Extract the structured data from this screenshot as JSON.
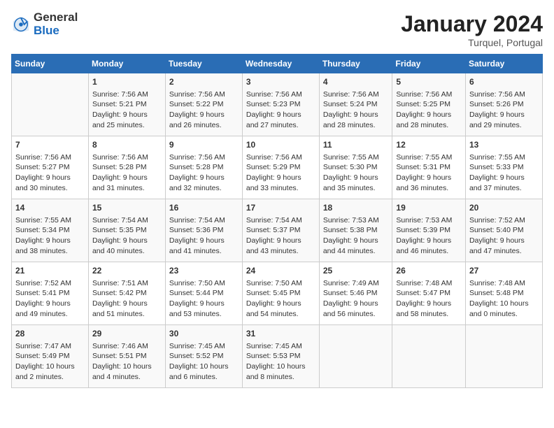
{
  "header": {
    "logo_general": "General",
    "logo_blue": "Blue",
    "title": "January 2024",
    "subtitle": "Turquel, Portugal"
  },
  "days_of_week": [
    "Sunday",
    "Monday",
    "Tuesday",
    "Wednesday",
    "Thursday",
    "Friday",
    "Saturday"
  ],
  "weeks": [
    [
      {
        "day": "",
        "info": ""
      },
      {
        "day": "1",
        "info": "Sunrise: 7:56 AM\nSunset: 5:21 PM\nDaylight: 9 hours\nand 25 minutes."
      },
      {
        "day": "2",
        "info": "Sunrise: 7:56 AM\nSunset: 5:22 PM\nDaylight: 9 hours\nand 26 minutes."
      },
      {
        "day": "3",
        "info": "Sunrise: 7:56 AM\nSunset: 5:23 PM\nDaylight: 9 hours\nand 27 minutes."
      },
      {
        "day": "4",
        "info": "Sunrise: 7:56 AM\nSunset: 5:24 PM\nDaylight: 9 hours\nand 28 minutes."
      },
      {
        "day": "5",
        "info": "Sunrise: 7:56 AM\nSunset: 5:25 PM\nDaylight: 9 hours\nand 28 minutes."
      },
      {
        "day": "6",
        "info": "Sunrise: 7:56 AM\nSunset: 5:26 PM\nDaylight: 9 hours\nand 29 minutes."
      }
    ],
    [
      {
        "day": "7",
        "info": "Sunrise: 7:56 AM\nSunset: 5:27 PM\nDaylight: 9 hours\nand 30 minutes."
      },
      {
        "day": "8",
        "info": "Sunrise: 7:56 AM\nSunset: 5:28 PM\nDaylight: 9 hours\nand 31 minutes."
      },
      {
        "day": "9",
        "info": "Sunrise: 7:56 AM\nSunset: 5:28 PM\nDaylight: 9 hours\nand 32 minutes."
      },
      {
        "day": "10",
        "info": "Sunrise: 7:56 AM\nSunset: 5:29 PM\nDaylight: 9 hours\nand 33 minutes."
      },
      {
        "day": "11",
        "info": "Sunrise: 7:55 AM\nSunset: 5:30 PM\nDaylight: 9 hours\nand 35 minutes."
      },
      {
        "day": "12",
        "info": "Sunrise: 7:55 AM\nSunset: 5:31 PM\nDaylight: 9 hours\nand 36 minutes."
      },
      {
        "day": "13",
        "info": "Sunrise: 7:55 AM\nSunset: 5:33 PM\nDaylight: 9 hours\nand 37 minutes."
      }
    ],
    [
      {
        "day": "14",
        "info": "Sunrise: 7:55 AM\nSunset: 5:34 PM\nDaylight: 9 hours\nand 38 minutes."
      },
      {
        "day": "15",
        "info": "Sunrise: 7:54 AM\nSunset: 5:35 PM\nDaylight: 9 hours\nand 40 minutes."
      },
      {
        "day": "16",
        "info": "Sunrise: 7:54 AM\nSunset: 5:36 PM\nDaylight: 9 hours\nand 41 minutes."
      },
      {
        "day": "17",
        "info": "Sunrise: 7:54 AM\nSunset: 5:37 PM\nDaylight: 9 hours\nand 43 minutes."
      },
      {
        "day": "18",
        "info": "Sunrise: 7:53 AM\nSunset: 5:38 PM\nDaylight: 9 hours\nand 44 minutes."
      },
      {
        "day": "19",
        "info": "Sunrise: 7:53 AM\nSunset: 5:39 PM\nDaylight: 9 hours\nand 46 minutes."
      },
      {
        "day": "20",
        "info": "Sunrise: 7:52 AM\nSunset: 5:40 PM\nDaylight: 9 hours\nand 47 minutes."
      }
    ],
    [
      {
        "day": "21",
        "info": "Sunrise: 7:52 AM\nSunset: 5:41 PM\nDaylight: 9 hours\nand 49 minutes."
      },
      {
        "day": "22",
        "info": "Sunrise: 7:51 AM\nSunset: 5:42 PM\nDaylight: 9 hours\nand 51 minutes."
      },
      {
        "day": "23",
        "info": "Sunrise: 7:50 AM\nSunset: 5:44 PM\nDaylight: 9 hours\nand 53 minutes."
      },
      {
        "day": "24",
        "info": "Sunrise: 7:50 AM\nSunset: 5:45 PM\nDaylight: 9 hours\nand 54 minutes."
      },
      {
        "day": "25",
        "info": "Sunrise: 7:49 AM\nSunset: 5:46 PM\nDaylight: 9 hours\nand 56 minutes."
      },
      {
        "day": "26",
        "info": "Sunrise: 7:48 AM\nSunset: 5:47 PM\nDaylight: 9 hours\nand 58 minutes."
      },
      {
        "day": "27",
        "info": "Sunrise: 7:48 AM\nSunset: 5:48 PM\nDaylight: 10 hours\nand 0 minutes."
      }
    ],
    [
      {
        "day": "28",
        "info": "Sunrise: 7:47 AM\nSunset: 5:49 PM\nDaylight: 10 hours\nand 2 minutes."
      },
      {
        "day": "29",
        "info": "Sunrise: 7:46 AM\nSunset: 5:51 PM\nDaylight: 10 hours\nand 4 minutes."
      },
      {
        "day": "30",
        "info": "Sunrise: 7:45 AM\nSunset: 5:52 PM\nDaylight: 10 hours\nand 6 minutes."
      },
      {
        "day": "31",
        "info": "Sunrise: 7:45 AM\nSunset: 5:53 PM\nDaylight: 10 hours\nand 8 minutes."
      },
      {
        "day": "",
        "info": ""
      },
      {
        "day": "",
        "info": ""
      },
      {
        "day": "",
        "info": ""
      }
    ]
  ]
}
